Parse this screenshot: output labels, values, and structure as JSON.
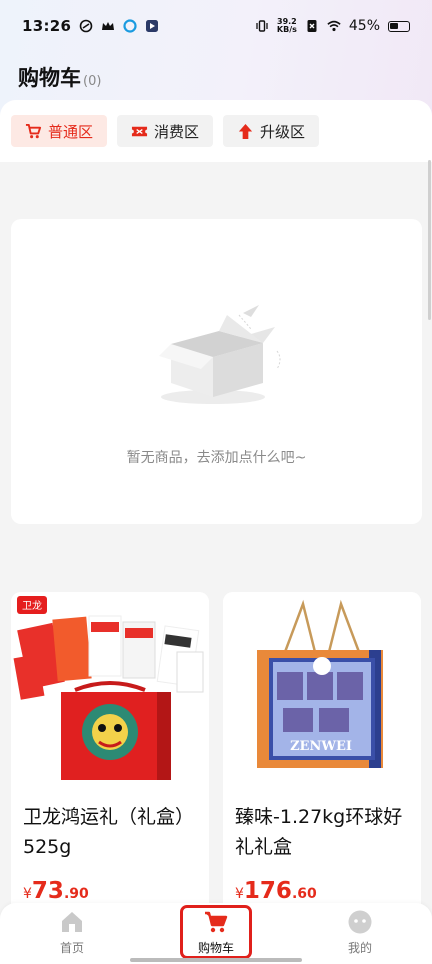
{
  "status_bar": {
    "time": "13:26",
    "net_speed_value": "39.2",
    "net_speed_unit": "KB/s",
    "battery_percent": "45%"
  },
  "header": {
    "title": "购物车",
    "count": "(0)"
  },
  "tabs": [
    {
      "label": "普通区",
      "icon": "cart-icon",
      "active": true
    },
    {
      "label": "消费区",
      "icon": "ticket-icon",
      "active": false
    },
    {
      "label": "升级区",
      "icon": "arrow-up-icon",
      "active": false
    }
  ],
  "empty_state": {
    "message": "暂无商品，去添加点什么吧~",
    "icon": "empty-box-icon"
  },
  "products": [
    {
      "name": "卫龙鸿运礼（礼盒）525g",
      "price_symbol": "¥",
      "price_int": "73",
      "price_dec": ".90",
      "image_logo": "卫龙"
    },
    {
      "name": "臻味-1.27kg环球好礼礼盒",
      "price_symbol": "¥",
      "price_int": "176",
      "price_dec": ".60",
      "image_logo": "ZENWEI"
    }
  ],
  "bottom_nav": [
    {
      "label": "首页",
      "icon": "home-icon",
      "active": false
    },
    {
      "label": "购物车",
      "icon": "cart-icon",
      "active": true
    },
    {
      "label": "我的",
      "icon": "profile-icon",
      "active": false
    }
  ],
  "colors": {
    "accent": "#e52b1b",
    "active_tab_bg": "#fde9e4",
    "page_bg": "#f4f4f4",
    "highlight_box": "#e0201b"
  }
}
